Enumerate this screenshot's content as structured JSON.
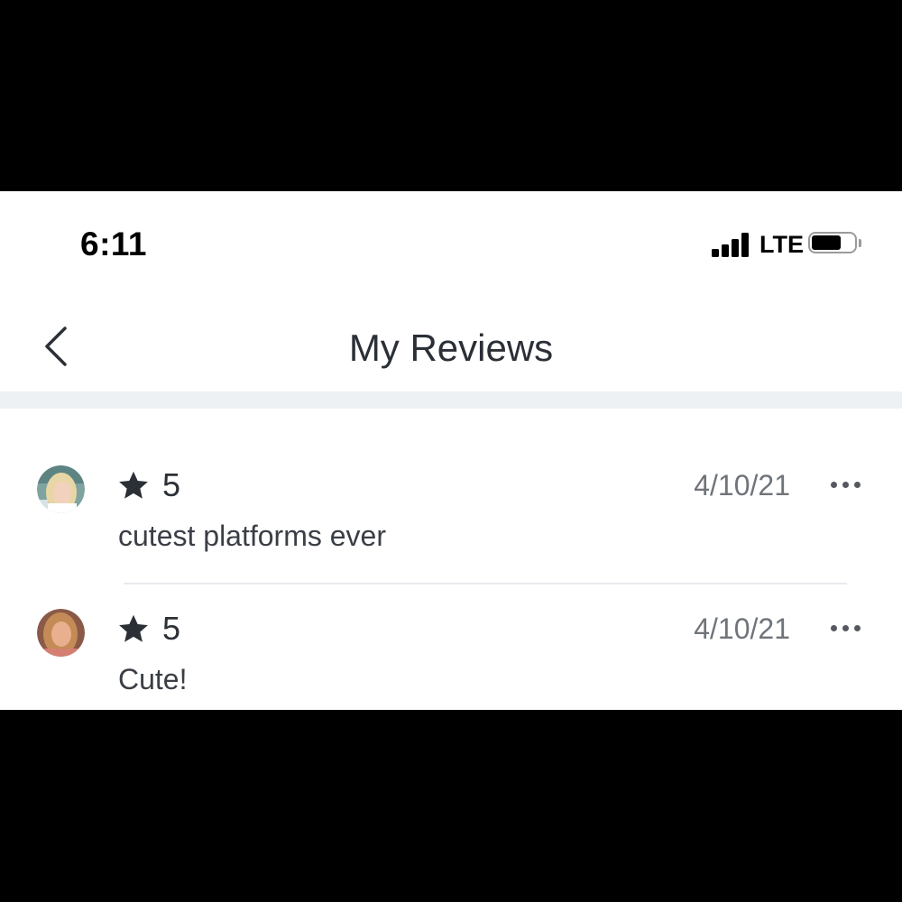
{
  "status_bar": {
    "time": "6:11",
    "network": "LTE",
    "signal_bars": 4,
    "battery_level": 0.7,
    "battery_icon": "battery-icon",
    "signal_icon": "cellular-signal-icon"
  },
  "nav": {
    "title": "My Reviews",
    "back_icon": "chevron-left-icon"
  },
  "reviews": [
    {
      "rating": "5",
      "date": "4/10/21",
      "text": "cutest platforms ever",
      "avatar_icon": "avatar",
      "star_icon": "star-icon",
      "more_icon": "more-options-icon"
    },
    {
      "rating": "5",
      "date": "4/10/21",
      "text": "Cute!",
      "avatar_icon": "avatar",
      "star_icon": "star-icon",
      "more_icon": "more-options-icon"
    }
  ],
  "colors": {
    "text_primary": "#2b2f36",
    "text_secondary": "#6f747b",
    "divider": "#eef1f4",
    "background": "#ffffff"
  }
}
